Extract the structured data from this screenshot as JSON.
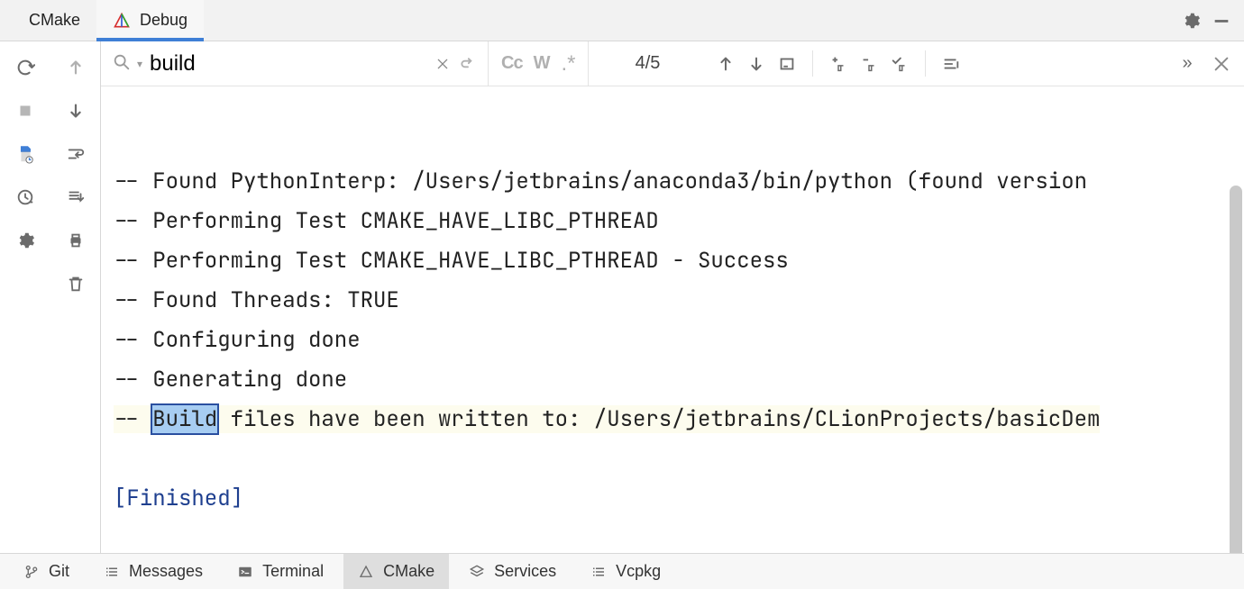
{
  "top_tabs": {
    "cmake": "CMake",
    "debug": "Debug"
  },
  "search": {
    "value": "build",
    "count": "4/5"
  },
  "console_lines": [
    "-- Found PythonInterp: /Users/jetbrains/anaconda3/bin/python (found version ",
    "-- Performing Test CMAKE_HAVE_LIBC_PTHREAD",
    "-- Performing Test CMAKE_HAVE_LIBC_PTHREAD - Success",
    "-- Found Threads: TRUE",
    "-- Configuring done",
    "-- Generating done"
  ],
  "console_match_line": {
    "prefix": "-- ",
    "match": "Build",
    "suffix": " files have been written to: /Users/jetbrains/CLionProjects/basicDem"
  },
  "console_finished": "[Finished]",
  "bottom_tools": {
    "git": "Git",
    "messages": "Messages",
    "terminal": "Terminal",
    "cmake": "CMake",
    "services": "Services",
    "vcpkg": "Vcpkg"
  }
}
